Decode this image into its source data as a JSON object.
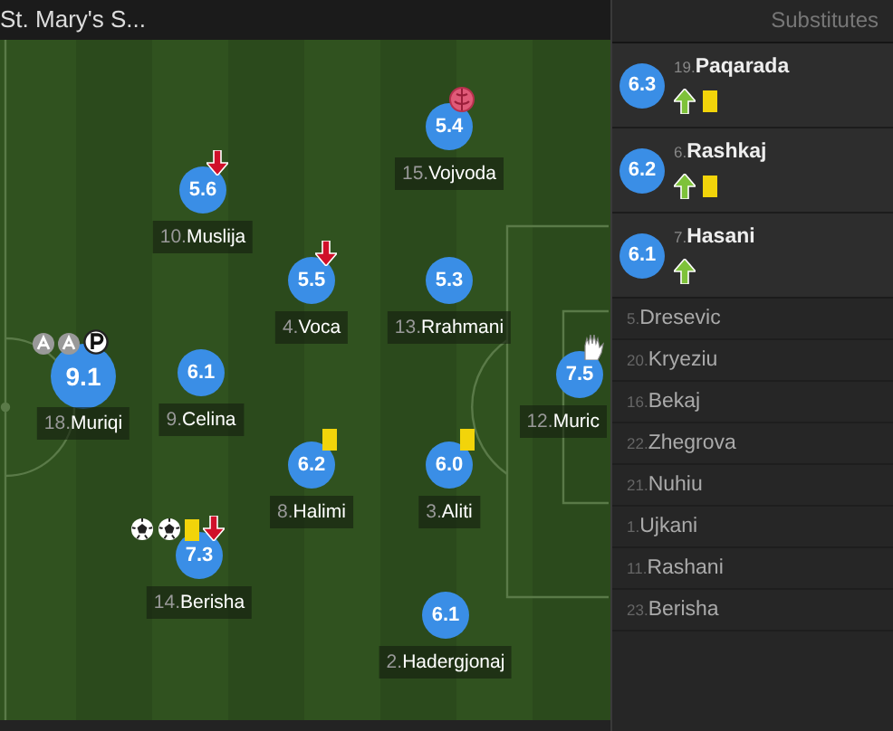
{
  "header": {
    "title": "St. Mary's S..."
  },
  "players": [
    {
      "number": "15.",
      "name": "Vojvoda",
      "rating": "5.4",
      "top": false,
      "events": [
        {
          "kind": "own-goal"
        }
      ]
    },
    {
      "number": "10.",
      "name": "Muslija",
      "rating": "5.6",
      "top": false,
      "events": [
        {
          "kind": "sub-off"
        }
      ]
    },
    {
      "number": "4.",
      "name": "Voca",
      "rating": "5.5",
      "top": false,
      "events": [
        {
          "kind": "sub-off"
        }
      ]
    },
    {
      "number": "13.",
      "name": "Rrahmani",
      "rating": "5.3",
      "top": false
    },
    {
      "number": "18.",
      "name": "Muriqi",
      "rating": "9.1",
      "top": true,
      "events": [
        {
          "kind": "assist"
        },
        {
          "kind": "assist"
        },
        {
          "kind": "penalty"
        }
      ]
    },
    {
      "number": "9.",
      "name": "Celina",
      "rating": "6.1",
      "top": false
    },
    {
      "number": "12.",
      "name": "Muric",
      "rating": "7.5",
      "top": false,
      "events": [
        {
          "kind": "save"
        }
      ]
    },
    {
      "number": "8.",
      "name": "Halimi",
      "rating": "6.2",
      "top": false,
      "events": [
        {
          "kind": "yellow"
        }
      ]
    },
    {
      "number": "3.",
      "name": "Aliti",
      "rating": "6.0",
      "top": false,
      "events": [
        {
          "kind": "yellow"
        }
      ]
    },
    {
      "number": "14.",
      "name": "Berisha",
      "rating": "7.3",
      "top": false,
      "events": [
        {
          "kind": "goal"
        },
        {
          "kind": "goal"
        },
        {
          "kind": "yellow"
        },
        {
          "kind": "sub-off"
        }
      ]
    },
    {
      "number": "2.",
      "name": "Hadergjonaj",
      "rating": "6.1",
      "top": false
    }
  ],
  "substitutes": {
    "title": "Substitutes",
    "used": [
      {
        "number": "19.",
        "name": "Paqarada",
        "rating": "6.3",
        "events": [
          {
            "kind": "sub-on"
          },
          {
            "kind": "yellow"
          }
        ]
      },
      {
        "number": "6.",
        "name": "Rashkaj",
        "rating": "6.2",
        "events": [
          {
            "kind": "sub-on"
          },
          {
            "kind": "yellow"
          }
        ]
      },
      {
        "number": "7.",
        "name": "Hasani",
        "rating": "6.1",
        "events": [
          {
            "kind": "sub-on"
          }
        ]
      }
    ],
    "unused": [
      {
        "number": "5.",
        "name": "Dresevic"
      },
      {
        "number": "20.",
        "name": "Kryeziu"
      },
      {
        "number": "16.",
        "name": "Bekaj"
      },
      {
        "number": "22.",
        "name": "Zhegrova"
      },
      {
        "number": "21.",
        "name": "Nuhiu"
      },
      {
        "number": "1.",
        "name": "Ujkani"
      },
      {
        "number": "11.",
        "name": "Rashani"
      },
      {
        "number": "23.",
        "name": "Berisha"
      }
    ]
  }
}
